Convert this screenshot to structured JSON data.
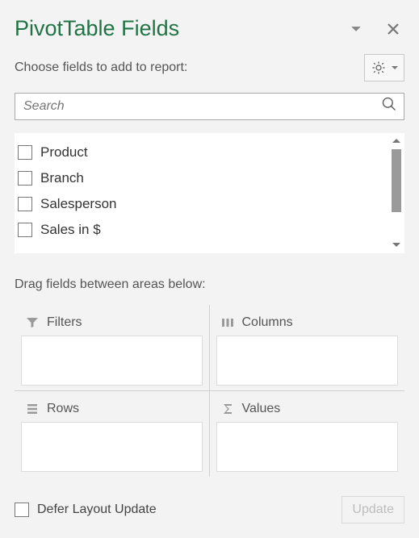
{
  "header": {
    "title": "PivotTable Fields"
  },
  "subheader": {
    "label": "Choose fields to add to report:"
  },
  "search": {
    "placeholder": "Search"
  },
  "fields": [
    {
      "label": "Product",
      "checked": false
    },
    {
      "label": "Branch",
      "checked": false
    },
    {
      "label": "Salesperson",
      "checked": false
    },
    {
      "label": "Sales in $",
      "checked": false
    }
  ],
  "drag_label": "Drag fields between areas below:",
  "areas": {
    "filters": {
      "label": "Filters"
    },
    "columns": {
      "label": "Columns"
    },
    "rows": {
      "label": "Rows"
    },
    "values": {
      "label": "Values"
    }
  },
  "footer": {
    "defer_label": "Defer Layout Update",
    "defer_checked": false,
    "update_label": "Update"
  }
}
